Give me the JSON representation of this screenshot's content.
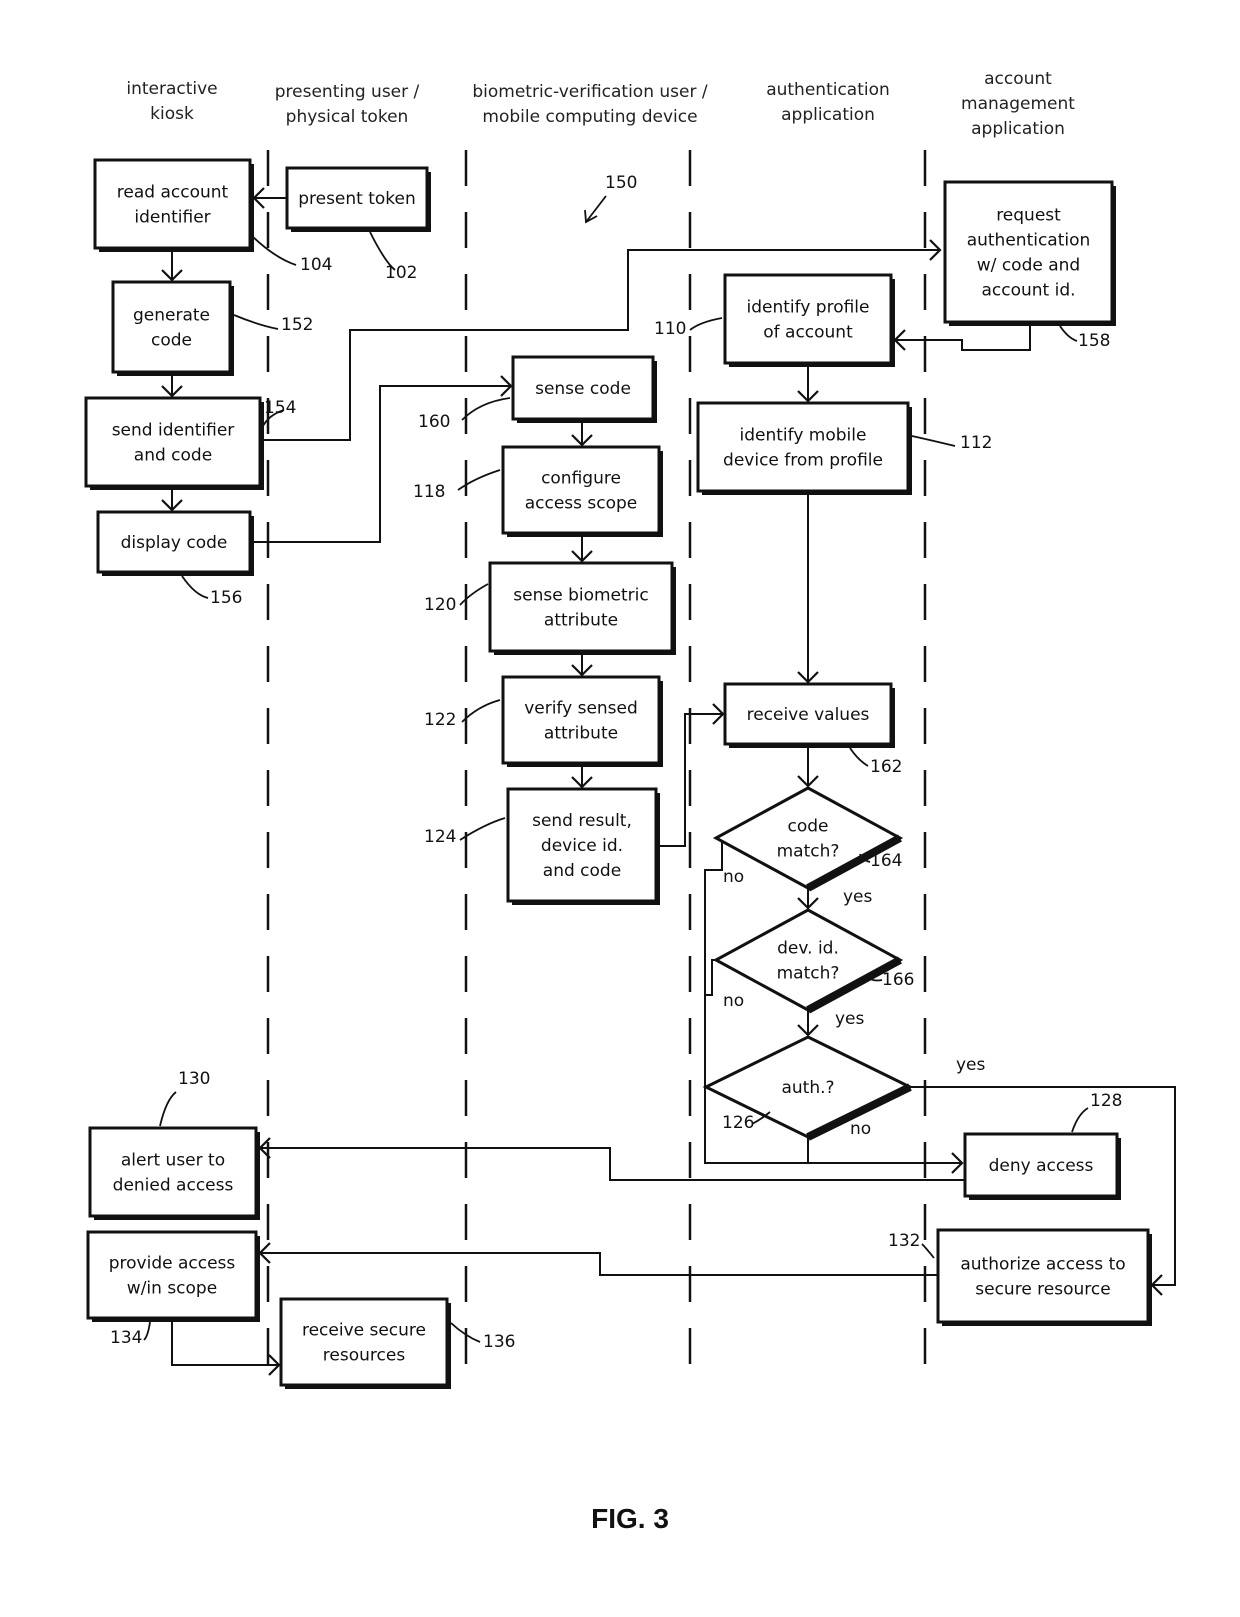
{
  "lanes": [
    {
      "id": "kiosk",
      "lines": [
        "interactive",
        "kiosk"
      ]
    },
    {
      "id": "presenting-user",
      "lines": [
        "presenting user /",
        "physical token"
      ]
    },
    {
      "id": "mobile-device",
      "lines": [
        "biometric-verification user /",
        "mobile computing device"
      ]
    },
    {
      "id": "auth-app",
      "lines": [
        "authentication",
        "application"
      ]
    },
    {
      "id": "account-mgmt",
      "lines": [
        "account",
        "management",
        "application"
      ]
    }
  ],
  "diagram_ref": "150",
  "nodes": {
    "present_token": {
      "ref": "102",
      "lines": [
        "present token"
      ]
    },
    "read_account_identifier": {
      "ref": "104",
      "lines": [
        "read account",
        "identifier"
      ]
    },
    "generate_code": {
      "ref": "152",
      "lines": [
        "generate",
        "code"
      ]
    },
    "send_identifier_and_code": {
      "ref": "154",
      "lines": [
        "send identifier",
        "and code"
      ]
    },
    "display_code": {
      "ref": "156",
      "lines": [
        "display code"
      ]
    },
    "request_authentication": {
      "ref": "158",
      "lines": [
        "request",
        "authentication",
        "w/ code and",
        "account id."
      ]
    },
    "identify_profile": {
      "ref": "110",
      "lines": [
        "identify profile",
        "of account"
      ]
    },
    "identify_mobile_device": {
      "ref": "112",
      "lines": [
        "identify mobile",
        "device from profile"
      ]
    },
    "sense_code": {
      "ref": "160",
      "lines": [
        "sense code"
      ]
    },
    "configure_access_scope": {
      "ref": "118",
      "lines": [
        "configure",
        "access scope"
      ]
    },
    "sense_biometric": {
      "ref": "120",
      "lines": [
        "sense biometric",
        "attribute"
      ]
    },
    "verify_sensed": {
      "ref": "122",
      "lines": [
        "verify sensed",
        "attribute"
      ]
    },
    "send_result": {
      "ref": "124",
      "lines": [
        "send result,",
        "device id.",
        "and code"
      ]
    },
    "receive_values": {
      "ref": "162",
      "lines": [
        "receive values"
      ]
    },
    "code_match": {
      "ref": "164",
      "lines": [
        "code",
        "match?"
      ]
    },
    "dev_id_match": {
      "ref": "166",
      "lines": [
        "dev. id.",
        "match?"
      ]
    },
    "auth": {
      "ref": "126",
      "lines": [
        "auth.?"
      ]
    },
    "deny_access": {
      "ref": "128",
      "lines": [
        "deny access"
      ]
    },
    "alert_user": {
      "ref": "130",
      "lines": [
        "alert user to",
        "denied access"
      ]
    },
    "authorize_access": {
      "ref": "132",
      "lines": [
        "authorize access to",
        "secure resource"
      ]
    },
    "provide_access": {
      "ref": "134",
      "lines": [
        "provide access",
        "w/in scope"
      ]
    },
    "receive_secure": {
      "ref": "136",
      "lines": [
        "receive secure",
        "resources"
      ]
    }
  },
  "branch_labels": {
    "yes": "yes",
    "no": "no"
  },
  "figure_caption": "FIG. 3"
}
